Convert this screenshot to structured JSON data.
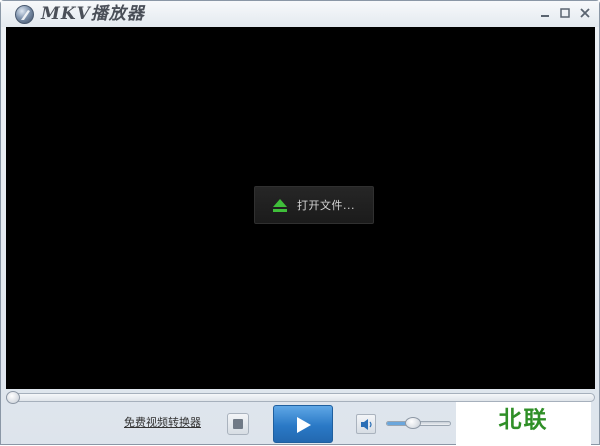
{
  "window": {
    "title": "MKV播放器",
    "controls": {
      "minimize_icon": "minimize-icon",
      "maximize_icon": "maximize-icon",
      "close_icon": "close-icon"
    }
  },
  "player": {
    "open_file_label": "打开文件...",
    "open_file_icon": "eject-icon"
  },
  "playback": {
    "seek_progress": 0,
    "volume_level": 0.42
  },
  "toolbar": {
    "converter_link": "免费视频转换器",
    "stop_icon": "stop-icon",
    "play_icon": "play-icon",
    "mute_icon": "speaker-icon"
  },
  "watermark": {
    "text": "北联"
  },
  "colors": {
    "accent": "#2a79c6",
    "eject_green": "#3fbf3a",
    "watermark_green": "#2f8f27",
    "video_bg": "#000000"
  }
}
